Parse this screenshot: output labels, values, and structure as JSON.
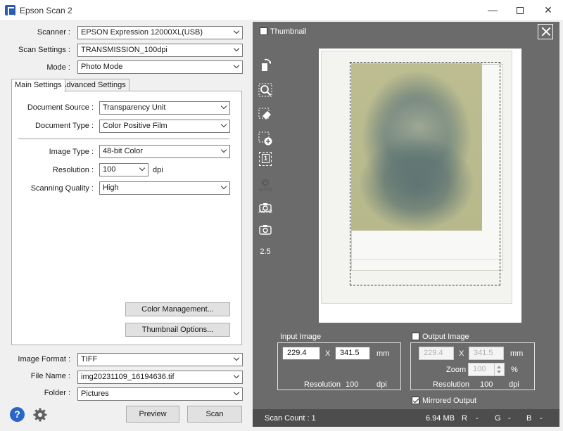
{
  "window": {
    "title": "Epson Scan 2"
  },
  "left": {
    "scanner_label": "Scanner :",
    "scanner_value": "EPSON Expression 12000XL(USB)",
    "scan_settings_label": "Scan Settings :",
    "scan_settings_value": "TRANSMISSION_100dpi",
    "mode_label": "Mode :",
    "mode_value": "Photo Mode",
    "tabs": [
      {
        "label": "Main Settings"
      },
      {
        "label": "Advanced Settings"
      }
    ],
    "document_source_label": "Document Source :",
    "document_source_value": "Transparency Unit",
    "document_type_label": "Document Type :",
    "document_type_value": "Color Positive Film",
    "image_type_label": "Image Type :",
    "image_type_value": "48-bit Color",
    "resolution_label": "Resolution :",
    "resolution_value": "100",
    "resolution_unit": "dpi",
    "quality_label": "Scanning Quality :",
    "quality_value": "High",
    "color_mgmt_button": "Color Management...",
    "thumbnail_options_button": "Thumbnail Options...",
    "image_format_label": "Image Format :",
    "image_format_value": "TIFF",
    "file_name_label": "File Name :",
    "file_name_value": "img20231109_16194636.tif",
    "folder_label": "Folder :",
    "folder_value": "Pictures",
    "preview_button": "Preview",
    "scan_button": "Scan"
  },
  "right": {
    "thumbnail_label": "Thumbnail",
    "toolbar_labels": {
      "auto1": "AUTO",
      "auto2": "AUTO",
      "zoom": "2.5",
      "page_num": "1"
    },
    "input_image": {
      "title": "Input Image",
      "width": "229.4",
      "x": "X",
      "height": "341.5",
      "unit": "mm",
      "resolution_label": "Resolution",
      "resolution_value": "100",
      "resolution_unit": "dpi"
    },
    "output_image": {
      "title": "Output Image",
      "width": "229.4",
      "x": "X",
      "height": "341.5",
      "unit": "mm",
      "zoom_label": "Zoom",
      "zoom_value": "100",
      "zoom_unit": "%",
      "resolution_label": "Resolution",
      "resolution_value": "100",
      "resolution_unit": "dpi"
    },
    "mirrored_output_label": "Mirrored Output",
    "status": {
      "scan_count": "Scan Count : 1",
      "size": "6.94 MB",
      "r": "R",
      "r_val": "-",
      "g": "G",
      "g_val": "-",
      "b": "B",
      "b_val": "-"
    }
  },
  "colors": {
    "pane_bg": "#6b6b6b",
    "status_bg": "#4d4d4d",
    "help_blue": "#2a66c8"
  }
}
